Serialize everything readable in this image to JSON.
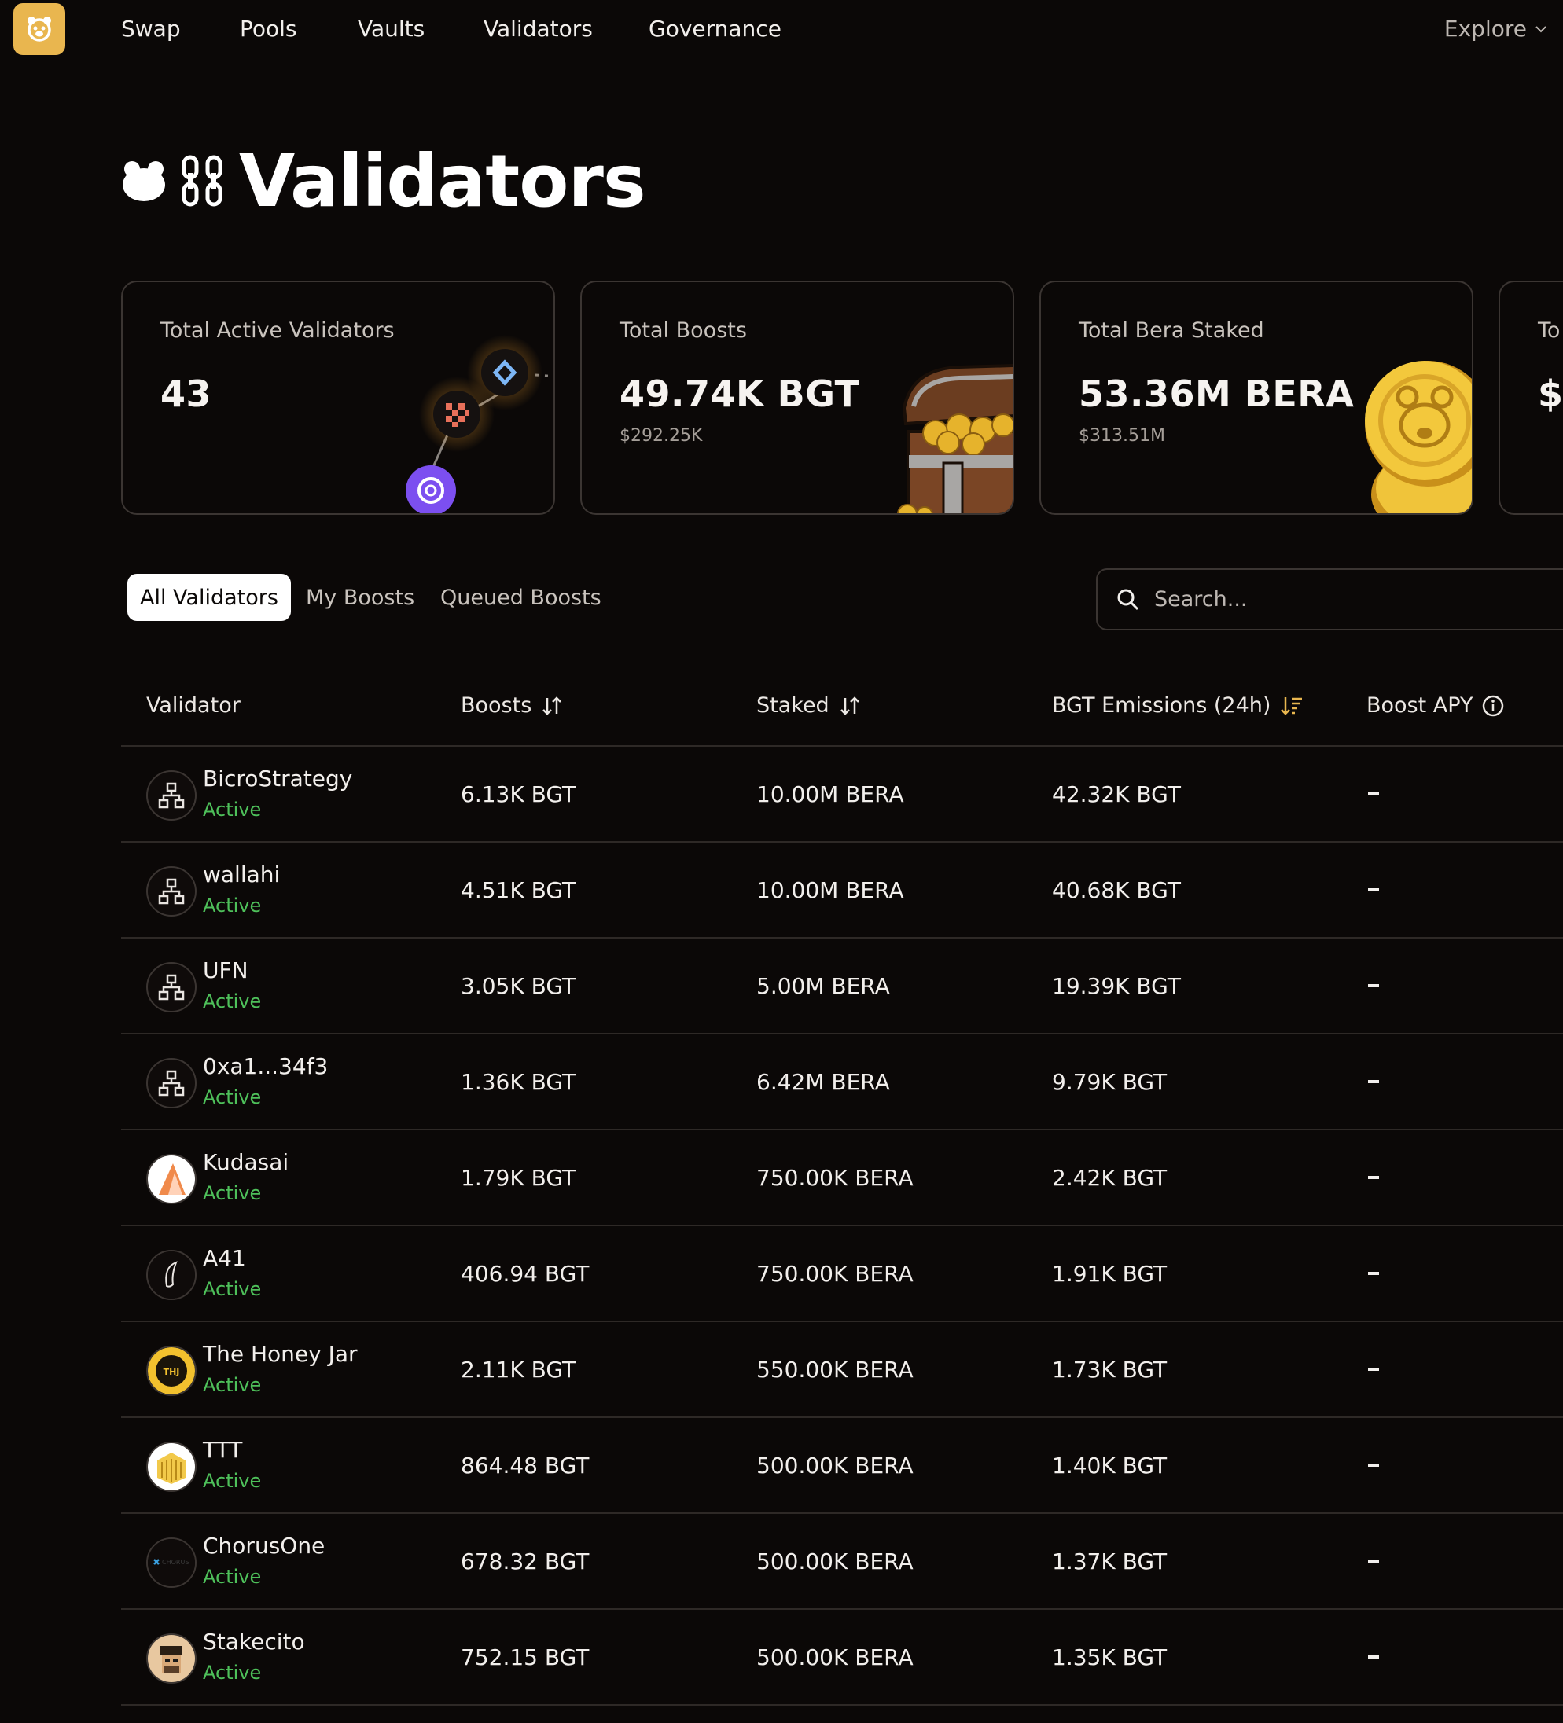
{
  "nav": {
    "items": [
      "Swap",
      "Pools",
      "Vaults",
      "Validators",
      "Governance"
    ],
    "explore": "Explore"
  },
  "page": {
    "title": "Validators"
  },
  "cards": [
    {
      "label": "Total Active Validators",
      "value": "43",
      "sub": ""
    },
    {
      "label": "Total Boosts",
      "value": "49.74K BGT",
      "sub": "$292.25K"
    },
    {
      "label": "Total Bera Staked",
      "value": "53.36M BERA",
      "sub": "$313.51M"
    },
    {
      "label": "To",
      "value": "$(",
      "sub": ""
    }
  ],
  "tabs": [
    "All Validators",
    "My Boosts",
    "Queued Boosts"
  ],
  "search": {
    "placeholder": "Search..."
  },
  "table": {
    "headers": {
      "validator": "Validator",
      "boosts": "Boosts",
      "staked": "Staked",
      "emissions": "BGT Emissions (24h)",
      "apy": "Boost APY"
    },
    "rows": [
      {
        "name": "BicroStrategy",
        "status": "Active",
        "boosts": "6.13K BGT",
        "staked": "10.00M BERA",
        "emissions": "42.32K BGT",
        "avatar": "network-icon"
      },
      {
        "name": "wallahi",
        "status": "Active",
        "boosts": "4.51K BGT",
        "staked": "10.00M BERA",
        "emissions": "40.68K BGT",
        "avatar": "network-icon"
      },
      {
        "name": "UFN",
        "status": "Active",
        "boosts": "3.05K BGT",
        "staked": "5.00M BERA",
        "emissions": "19.39K BGT",
        "avatar": "network-icon"
      },
      {
        "name": "0xa1...34f3",
        "status": "Active",
        "boosts": "1.36K BGT",
        "staked": "6.42M BERA",
        "emissions": "9.79K BGT",
        "avatar": "network-icon"
      },
      {
        "name": "Kudasai",
        "status": "Active",
        "boosts": "1.79K BGT",
        "staked": "750.00K BERA",
        "emissions": "2.42K BGT",
        "avatar": "kudasai-logo"
      },
      {
        "name": "A41",
        "status": "Active",
        "boosts": "406.94 BGT",
        "staked": "750.00K BERA",
        "emissions": "1.91K BGT",
        "avatar": "a41-logo"
      },
      {
        "name": "The Honey Jar",
        "status": "Active",
        "boosts": "2.11K BGT",
        "staked": "550.00K BERA",
        "emissions": "1.73K BGT",
        "avatar": "honey-jar-logo"
      },
      {
        "name": "TTT",
        "status": "Active",
        "boosts": "864.48 BGT",
        "staked": "500.00K BERA",
        "emissions": "1.40K BGT",
        "avatar": "ttt-logo"
      },
      {
        "name": "ChorusOne",
        "status": "Active",
        "boosts": "678.32 BGT",
        "staked": "500.00K BERA",
        "emissions": "1.37K BGT",
        "avatar": "chorusone-logo"
      },
      {
        "name": "Stakecito",
        "status": "Active",
        "boosts": "752.15 BGT",
        "staked": "500.00K BERA",
        "emissions": "1.35K BGT",
        "avatar": "stakecito-logo"
      }
    ]
  },
  "colors": {
    "background": "#0b0807",
    "active": "#4ec05a",
    "accent": "#e9b64f",
    "border": "#3b3532"
  }
}
